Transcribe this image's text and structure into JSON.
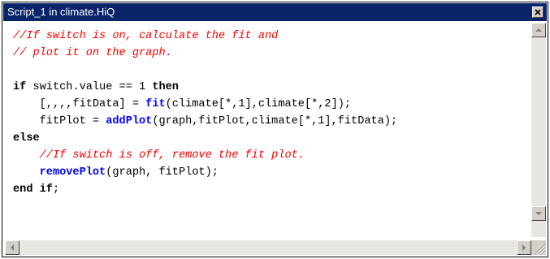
{
  "window": {
    "title": "Script_1 in climate.HiQ"
  },
  "code_lines": [
    [
      {
        "t": "//If switch is on, calculate the fit and",
        "c": "cm"
      }
    ],
    [
      {
        "t": "// plot it on the graph.",
        "c": "cm"
      }
    ],
    [],
    [
      {
        "t": "if",
        "c": "kw"
      },
      {
        "t": " switch.value == 1 "
      },
      {
        "t": "then",
        "c": "kw"
      }
    ],
    [
      {
        "t": "    [,,,,fitData] = "
      },
      {
        "t": "fit",
        "c": "fn"
      },
      {
        "t": "(climate[*,1],climate[*,2]);"
      }
    ],
    [
      {
        "t": "    fitPlot = "
      },
      {
        "t": "addPlot",
        "c": "fn"
      },
      {
        "t": "(graph,fitPlot,climate[*,1],fitData);"
      }
    ],
    [
      {
        "t": "else",
        "c": "kw"
      }
    ],
    [
      {
        "t": "    "
      },
      {
        "t": "//If switch is off, remove the fit plot.",
        "c": "cm"
      }
    ],
    [
      {
        "t": "    "
      },
      {
        "t": "removePlot",
        "c": "fn"
      },
      {
        "t": "(graph, fitPlot);"
      }
    ],
    [
      {
        "t": "end if",
        "c": "kw"
      },
      {
        "t": ";"
      }
    ]
  ],
  "colors": {
    "titlebar": "#0a246a",
    "comment": "#ff0000",
    "function": "#0000ff",
    "keyword": "#000000"
  },
  "icons": {
    "close": "close-icon",
    "scroll_up": "arrow-up-icon",
    "scroll_down": "arrow-down-icon",
    "scroll_left": "arrow-left-icon",
    "scroll_right": "arrow-right-icon",
    "resize": "resize-grip-icon"
  }
}
